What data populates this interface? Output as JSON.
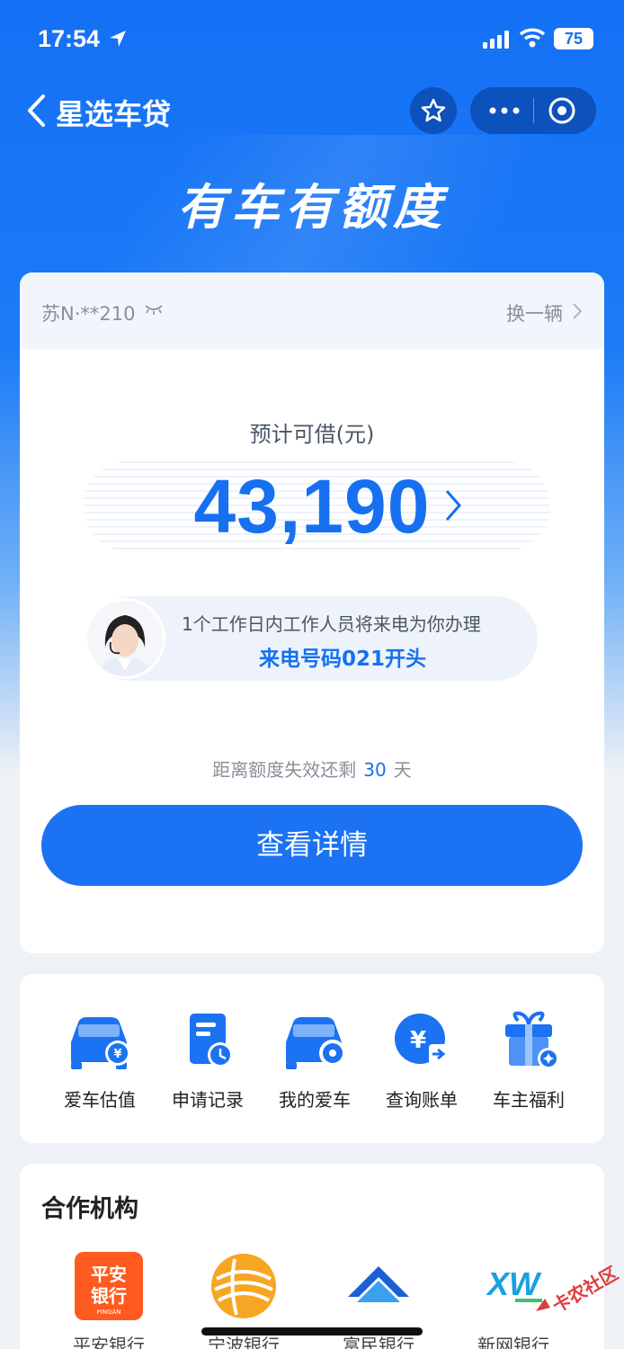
{
  "status_bar": {
    "time": "17:54",
    "battery": "75"
  },
  "nav": {
    "title": "星选车贷"
  },
  "hero": {
    "title": "有车有额度"
  },
  "vehicle": {
    "plate": "苏N·**210",
    "switch_label": "换一辆"
  },
  "loan": {
    "label": "预计可借(元)",
    "amount": "43,190",
    "agent_notice": "1个工作日内工作人员将来电为你办理",
    "agent_phone": "来电号码021开头",
    "expire_prefix": "距离额度失效还剩",
    "expire_days": "30",
    "expire_suffix": "天",
    "detail_button": "查看详情"
  },
  "quick_menu": [
    {
      "label": "爱车估值",
      "icon": "car-yuan-icon"
    },
    {
      "label": "申请记录",
      "icon": "record-clock-icon"
    },
    {
      "label": "我的爱车",
      "icon": "car-gear-icon"
    },
    {
      "label": "查询账单",
      "icon": "yuan-bill-icon"
    },
    {
      "label": "车主福利",
      "icon": "gift-icon"
    }
  ],
  "partners": {
    "title": "合作机构",
    "items": [
      {
        "name": "平安银行",
        "logo_text": "平安\n银行",
        "logo_sub": "PINGAN"
      },
      {
        "name": "宁波银行",
        "logo_text": ""
      },
      {
        "name": "富民银行",
        "logo_text": ""
      },
      {
        "name": "新网银行",
        "logo_text": "XW"
      }
    ]
  },
  "watermark": {
    "text": "卡农社区"
  },
  "colors": {
    "primary": "#1670f0",
    "header": "#1470f5",
    "pingan": "#ff5a1f"
  }
}
